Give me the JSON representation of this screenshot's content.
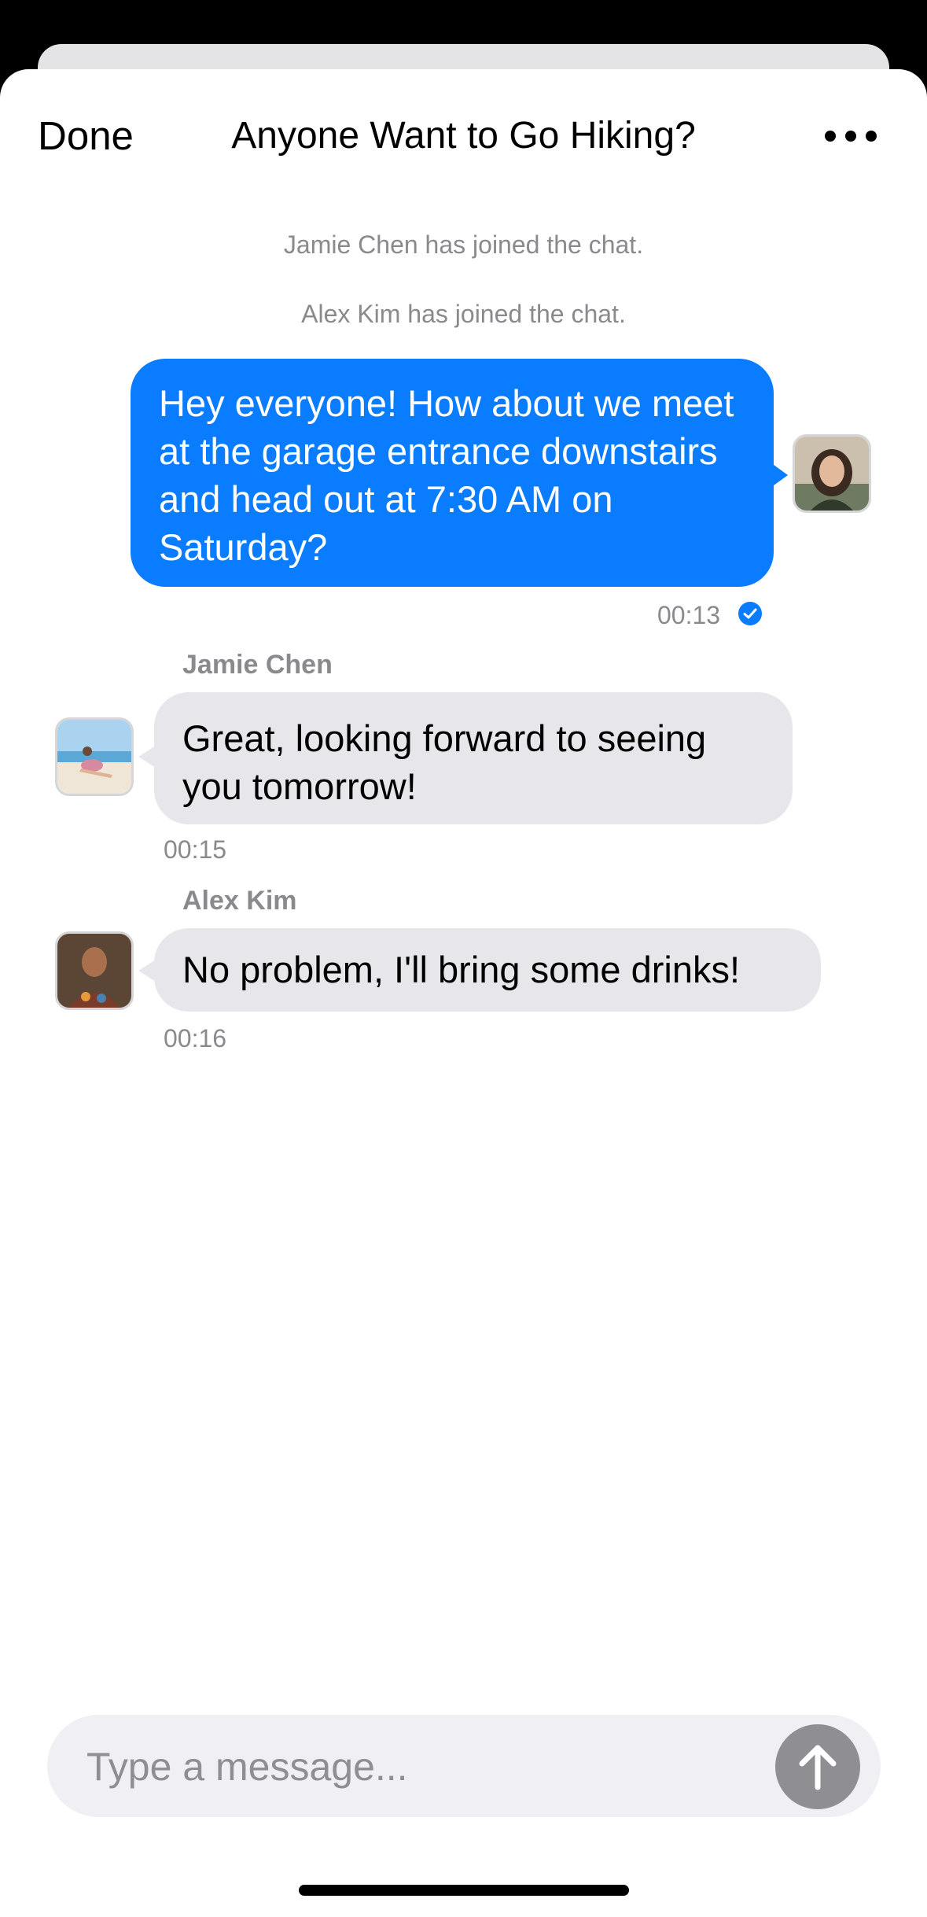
{
  "header": {
    "done_label": "Done",
    "title": "Anyone Want to Go Hiking?",
    "more_icon": "ellipsis-icon"
  },
  "system_messages": [
    "Jamie Chen has joined the chat.",
    "Alex Kim has joined the chat."
  ],
  "messages": [
    {
      "direction": "outgoing",
      "text": "Hey everyone! How about we meet at the garage entrance downstairs and head out at 7:30 AM on Saturday?",
      "time": "00:13",
      "status_icon": "read-checkmark-icon"
    },
    {
      "direction": "incoming",
      "sender": "Jamie Chen",
      "text": "Great, looking forward to seeing you tomorrow!",
      "time": "00:15"
    },
    {
      "direction": "incoming",
      "sender": "Alex Kim",
      "text": "No problem, I'll bring some drinks!",
      "time": "00:16"
    }
  ],
  "composer": {
    "placeholder": "Type a message...",
    "value": "",
    "send_icon": "arrow-up-icon"
  },
  "colors": {
    "accent": "#0A7CFF",
    "incoming_bubble": "#E6E6EB",
    "muted_text": "#8A8A8E",
    "send_button": "#8E8E93"
  }
}
